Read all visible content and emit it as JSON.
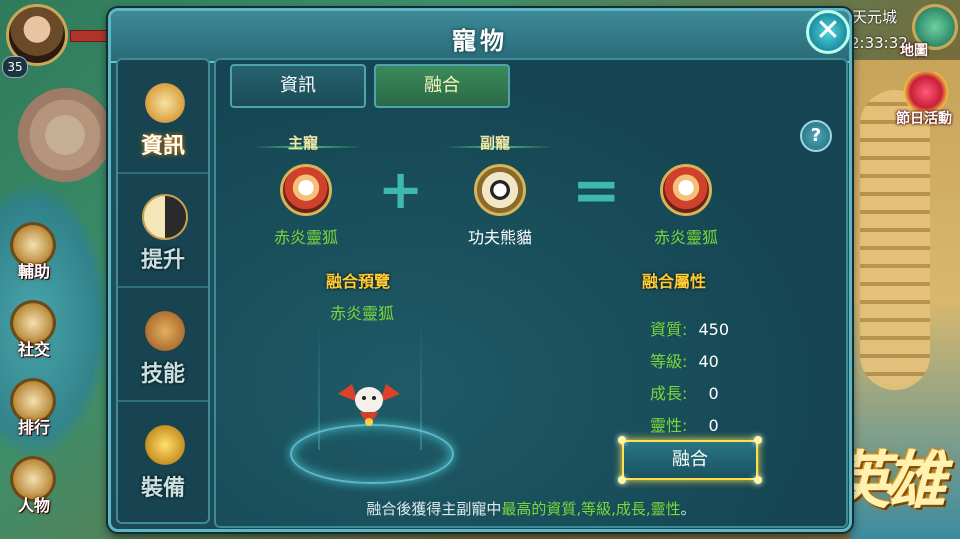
{
  "hud": {
    "level": "35",
    "location": "天元城",
    "clock": "2:33:32",
    "map_label": "地圖",
    "festival_label": "節日活動"
  },
  "left_menu": [
    "輔助",
    "社交",
    "排行",
    "人物"
  ],
  "logo_text": "大英雄",
  "window": {
    "title": "寵物",
    "close_label": "✕",
    "help_label": "?"
  },
  "nav": [
    {
      "label": "資訊",
      "icon": "scroll-icon",
      "active": true
    },
    {
      "label": "提升",
      "icon": "yin-yang-icon",
      "active": false
    },
    {
      "label": "技能",
      "icon": "skill-book-icon",
      "active": false
    },
    {
      "label": "裝備",
      "icon": "paw-icon",
      "active": false
    }
  ],
  "tabs": [
    {
      "label": "資訊",
      "active": false
    },
    {
      "label": "融合",
      "active": true
    }
  ],
  "fusion": {
    "main_label": "主寵",
    "sub_label": "副寵",
    "main_pet": "赤炎靈狐",
    "sub_pet": "功夫熊貓",
    "result_pet": "赤炎靈狐",
    "plus": "+",
    "equals": "="
  },
  "preview": {
    "heading": "融合預覽",
    "pet_name": "赤炎靈狐"
  },
  "attributes": {
    "heading": "融合屬性",
    "rows": [
      {
        "label": "資質:",
        "value": "450"
      },
      {
        "label": "等級:",
        "value": "40"
      },
      {
        "label": "成長:",
        "value": "0"
      },
      {
        "label": "靈性:",
        "value": "0"
      }
    ],
    "button_label": "融合"
  },
  "note": {
    "prefix": "融合後獲得主副寵中",
    "highlight": "最高的資質,等級,成長,靈性",
    "suffix": "。"
  }
}
